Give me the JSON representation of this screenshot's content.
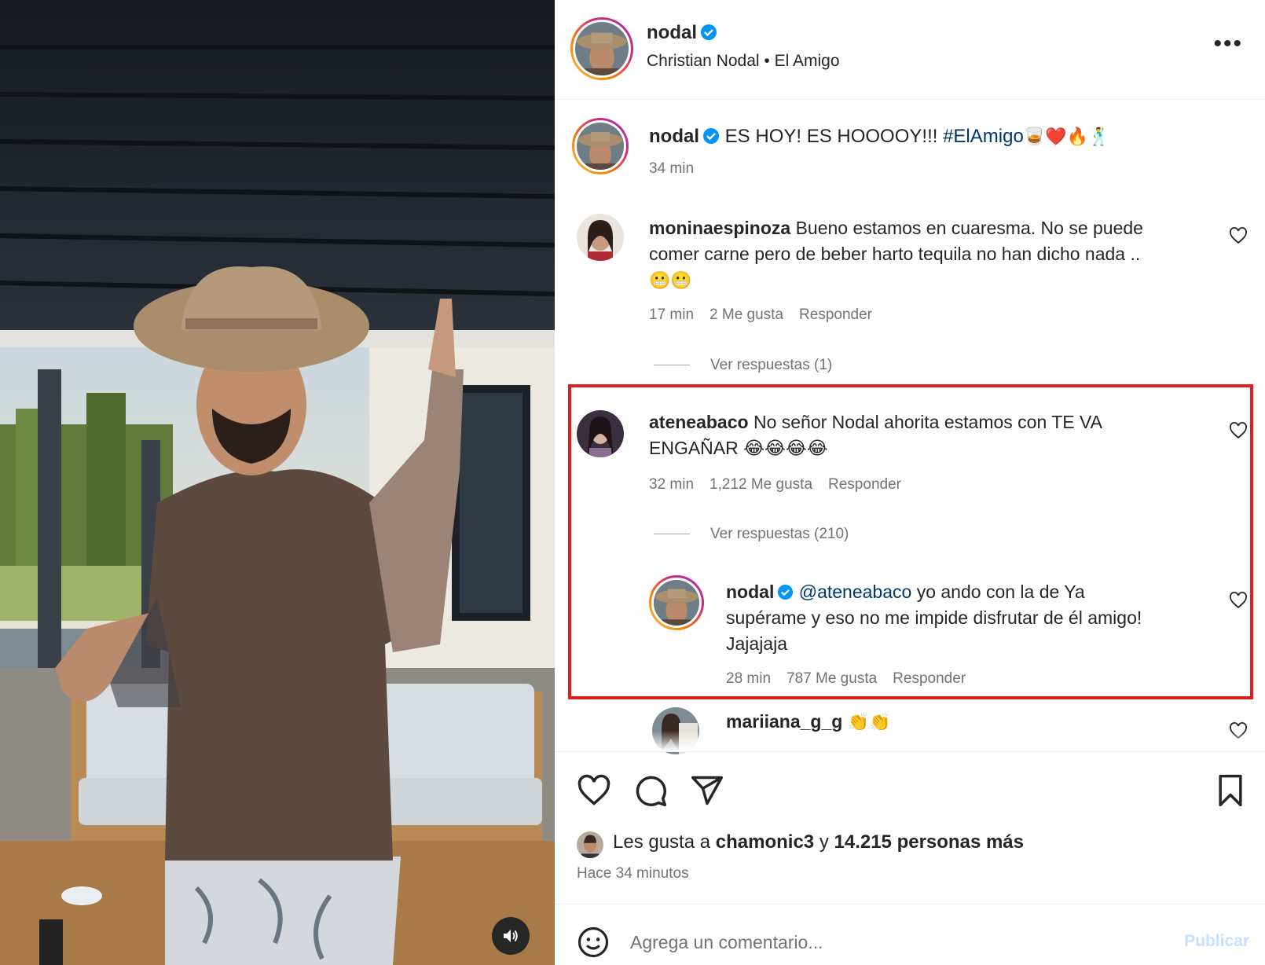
{
  "media": {
    "sound_icon": "speaker-icon",
    "colors": {
      "ceiling": "#1f252d",
      "shirt": "#5b4a3d",
      "hat": "#b29a7a",
      "cushions": "#d8dde2"
    }
  },
  "post": {
    "author": "nodal",
    "subtitle_artist": "Christian Nodal",
    "subtitle_separator": "•",
    "subtitle_song": "El Amigo",
    "more_icon": "more-options-icon",
    "caption": {
      "username": "nodal",
      "text": "ES HOY! ES HOOOOY!!! ",
      "hashtag": "#ElAmigo",
      "emojis": "🥃❤️🔥🕺",
      "time": "34 min"
    },
    "comments": [
      {
        "username": "moninaespinoza",
        "text_line1": "Bueno estamos en cuaresma. No se puede",
        "text_line2": "comer carne pero de beber harto tequila no han dicho nada ..",
        "text_line3": "😬😬",
        "time": "17 min",
        "likes": "2 Me gusta",
        "reply_label": "Responder",
        "view_replies": "Ver respuestas (1)"
      },
      {
        "username": "ateneabaco",
        "text_line1": "No señor Nodal ahorita estamos con TE VA",
        "text_line2": "ENGAÑAR 😂😂😂😂",
        "time": "32 min",
        "likes": "1,212 Me gusta",
        "reply_label": "Responder",
        "view_replies": "Ver respuestas (210)"
      },
      {
        "username": "nodal",
        "mention": "@ateneabaco",
        "text_line1": " yo ando con la de Ya",
        "text_line2": "supérame y eso no me impide disfrutar de él amigo!",
        "text_line3": "Jajajaja",
        "time": "28 min",
        "likes": "787 Me gusta",
        "reply_label": "Responder"
      },
      {
        "username": "mariiana_g_g",
        "text": "👏👏"
      }
    ],
    "actions": {
      "like_icon": "heart-icon",
      "comment_icon": "comment-icon",
      "share_icon": "share-icon",
      "save_icon": "bookmark-icon"
    },
    "likes_prefix": "Les gusta a ",
    "likes_user": "chamonic3",
    "likes_mid": " y ",
    "likes_count": "14.215 personas más",
    "posted_ago": "Hace 34 minutos",
    "composer": {
      "emoji_icon": "emoji-icon",
      "placeholder": "Agrega un comentario...",
      "submit_label": "Publicar"
    }
  }
}
